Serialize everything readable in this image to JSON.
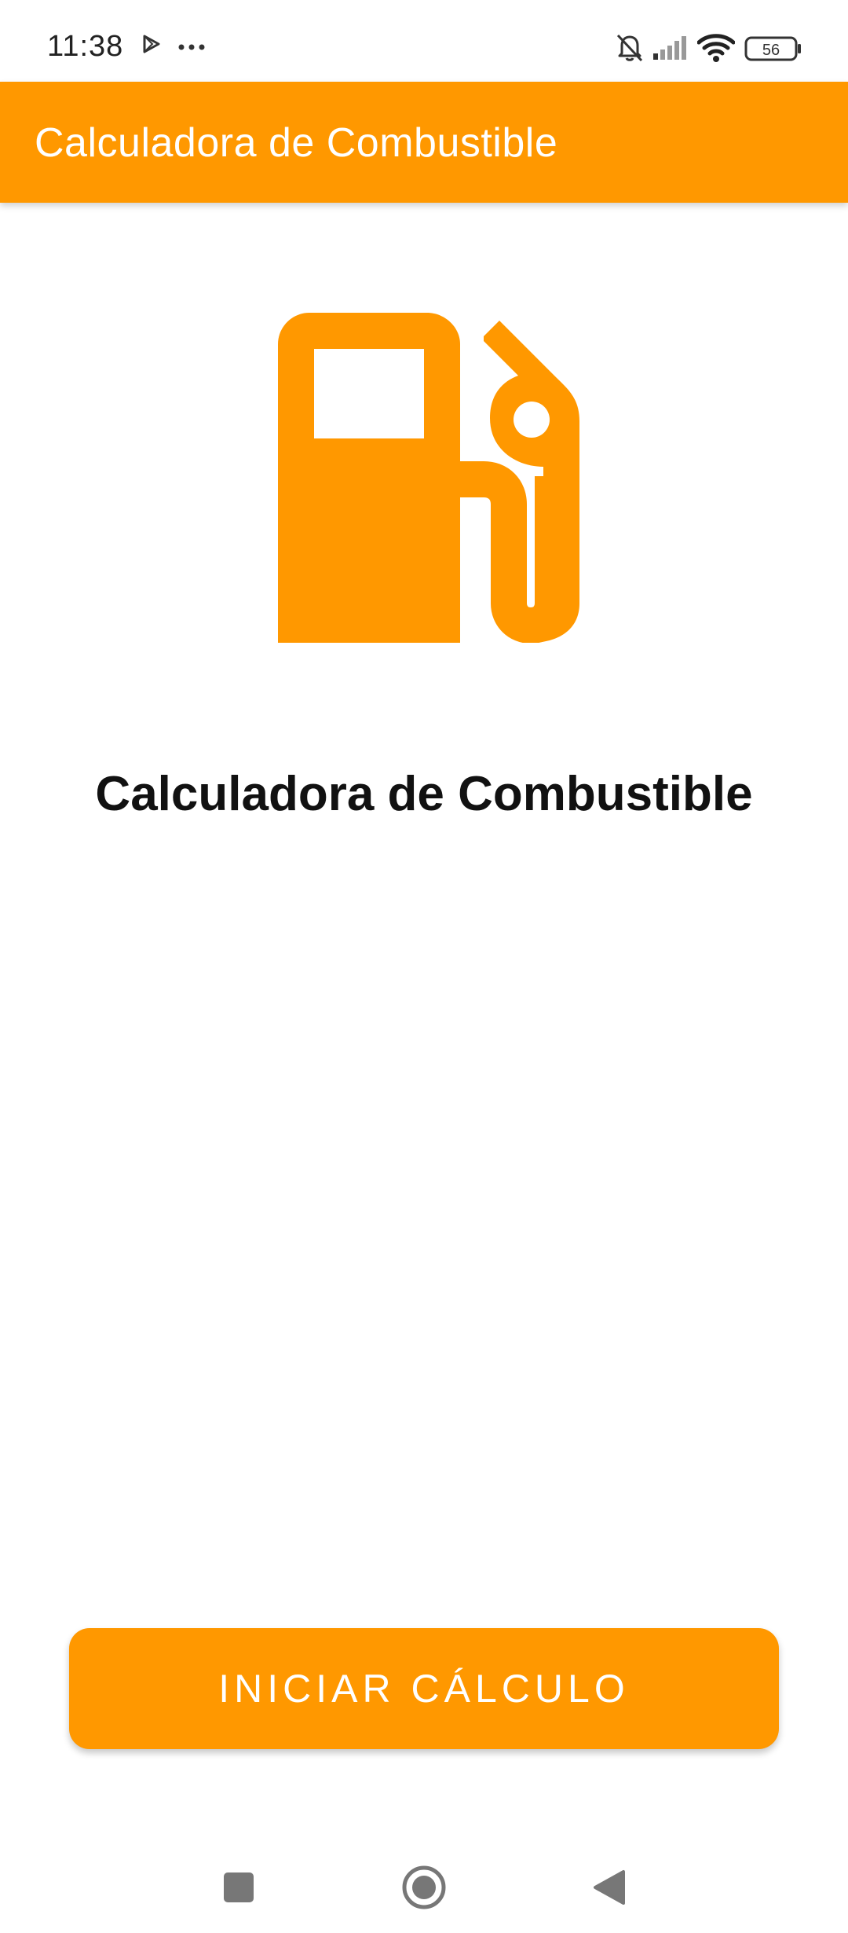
{
  "status_bar": {
    "time": "11:38",
    "battery": "56",
    "icons": [
      "play-store-icon",
      "more-dots-icon",
      "bell-muted-icon",
      "signal-icon",
      "wifi-icon",
      "battery-icon"
    ]
  },
  "app_bar": {
    "title": "Calculadora de Combustible",
    "color": "#FF9800"
  },
  "main": {
    "icon": "local-gas-station-icon",
    "heading": "Calculadora de Combustible"
  },
  "action": {
    "button_label": "INICIAR CÁLCULO"
  },
  "nav_bar": {
    "icons": [
      "recents-square-icon",
      "home-circle-icon",
      "back-triangle-icon"
    ]
  },
  "colors": {
    "accent": "#FF9800",
    "text_dark": "#111111",
    "background": "#FFFFFF"
  }
}
